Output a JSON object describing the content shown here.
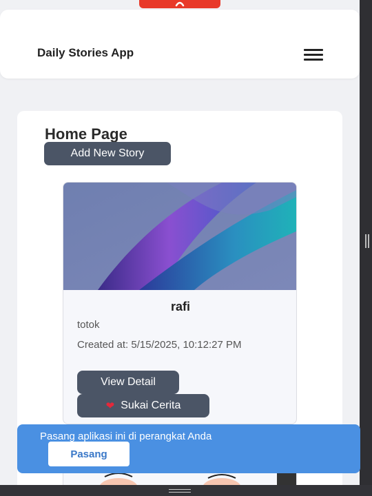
{
  "header": {
    "app_title": "Daily Stories App",
    "menu_icon": "hamburger-menu-icon"
  },
  "main": {
    "page_title": "Home Page",
    "add_story_label": "Add New Story",
    "stories": [
      {
        "name": "rafi",
        "description": "totok",
        "created_at": "Created at: 5/15/2025, 10:12:27 PM",
        "view_label": "View Detail",
        "like_label": "Sukai Cerita",
        "like_icon": "heart-icon"
      }
    ]
  },
  "install_banner": {
    "text": "Pasang aplikasi ini di perangkat Anda",
    "button_label": "Pasang"
  },
  "colors": {
    "top_tab": "#e8392a",
    "button_bg": "#4b5566",
    "banner_bg": "#4a90e2",
    "heart": "#e5283a"
  }
}
